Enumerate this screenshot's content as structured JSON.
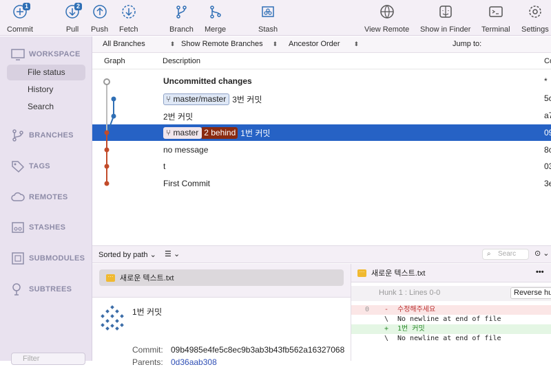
{
  "toolbar": {
    "commit": {
      "label": "Commit",
      "badge": "1"
    },
    "pull": {
      "label": "Pull",
      "badge": "2"
    },
    "push": {
      "label": "Push"
    },
    "fetch": {
      "label": "Fetch"
    },
    "branch": {
      "label": "Branch"
    },
    "merge": {
      "label": "Merge"
    },
    "stash": {
      "label": "Stash"
    },
    "view_remote": {
      "label": "View Remote"
    },
    "show_in_finder": {
      "label": "Show in Finder"
    },
    "terminal": {
      "label": "Terminal"
    },
    "settings": {
      "label": "Settings"
    }
  },
  "sidebar": {
    "workspace": "WORKSPACE",
    "items": [
      "File status",
      "History",
      "Search"
    ],
    "branches": "BRANCHES",
    "tags": "TAGS",
    "remotes": "REMOTES",
    "stashes": "STASHES",
    "submodules": "SUBMODULES",
    "subtrees": "SUBTREES",
    "filter_placeholder": "Filter"
  },
  "filterbar": {
    "branches": "All Branches",
    "remote": "Show Remote Branches",
    "order": "Ancestor Order",
    "jump": "Jump to:"
  },
  "columns": {
    "graph": "Graph",
    "description": "Description",
    "commit": "Co"
  },
  "commits": [
    {
      "desc": "Uncommitted changes",
      "hash": "*"
    },
    {
      "tag": "master/master",
      "desc": "3번 커밋",
      "hash": "5c"
    },
    {
      "desc": "2번 커밋",
      "hash": "a7"
    },
    {
      "tag": "master",
      "behind": "2 behind",
      "desc": "1번 커밋",
      "hash": "09"
    },
    {
      "desc": "no message",
      "hash": "8c"
    },
    {
      "desc": "t",
      "hash": "03"
    },
    {
      "desc": "First Commit",
      "hash": "3e"
    }
  ],
  "lower": {
    "sort": "Sorted by path",
    "search_placeholder": "Searc",
    "file": "새로운 텍스트.txt"
  },
  "details": {
    "message": "1번 커밋",
    "commit_label": "Commit:",
    "commit_hash": "09b4985e4fe5c8ec9b3ab3b43fb562a16327068",
    "parents_label": "Parents:",
    "parents_hash": "0d36aab308"
  },
  "diff": {
    "file": "새로운 텍스트.txt",
    "hunk": "Hunk 1 : Lines 0-0",
    "reverse": "Reverse hu",
    "line_no": "0",
    "lines": [
      {
        "g": "-",
        "t": "수정해주세요"
      },
      {
        "g": "\\",
        "t": "No newline at end of file"
      },
      {
        "g": "+",
        "t": "1번 커밋"
      },
      {
        "g": "\\",
        "t": "No newline at end of file"
      }
    ]
  },
  "colors": {
    "accent": "#2f6fb5",
    "selection": "#2662c5",
    "graph_blue": "#2f6fb5",
    "graph_red": "#c24b2a",
    "behind": "#8a2a10"
  }
}
